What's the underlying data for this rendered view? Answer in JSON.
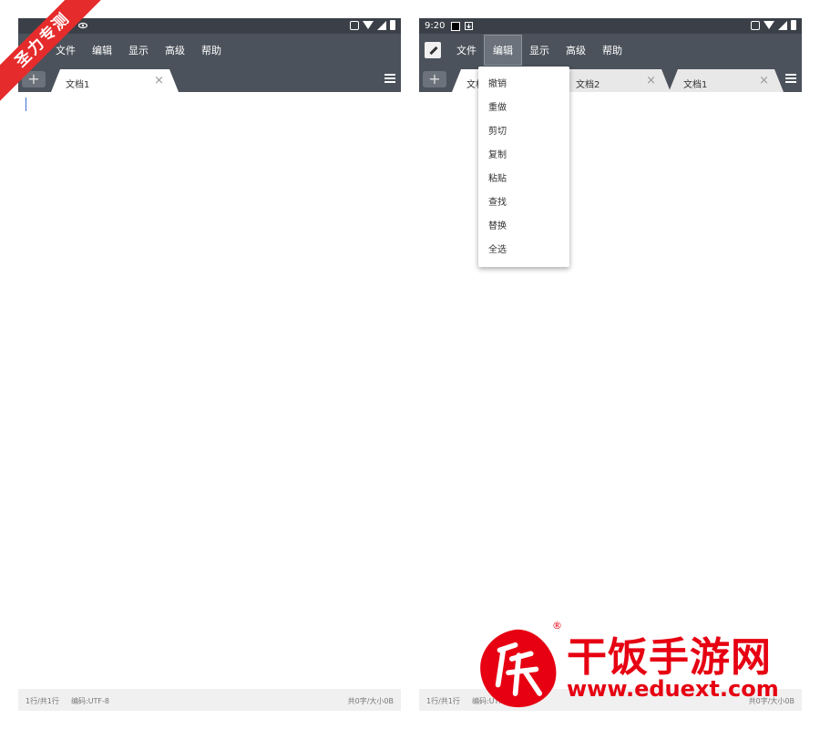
{
  "left": {
    "menu": [
      "文件",
      "编辑",
      "显示",
      "高级",
      "帮助"
    ],
    "tabs": [
      {
        "label": "文档1",
        "close": "×"
      }
    ],
    "add_tab": "+",
    "footer": {
      "lines": "1行/共1行",
      "encoding": "编码:UTF-8",
      "stats": "共0字/大小0B"
    }
  },
  "right": {
    "status_time": "9:20",
    "menu": [
      "文件",
      "编辑",
      "显示",
      "高级",
      "帮助"
    ],
    "active_menu": "编辑",
    "tabs": [
      {
        "label": "文档",
        "close": "×"
      },
      {
        "label": "文档2",
        "close": "×"
      },
      {
        "label": "文档1",
        "close": "×"
      }
    ],
    "add_tab": "+",
    "edit_menu_items": [
      "撤销",
      "重做",
      "剪切",
      "复制",
      "粘贴",
      "查找",
      "替换",
      "全选"
    ],
    "footer": {
      "lines": "1行/共1行",
      "encoding": "编码:UTF-8",
      "stats": "共0字/大小0B"
    }
  },
  "ribbon": "圣力专测",
  "watermark": {
    "name": "干饭手游网",
    "url": "www.eduext.com",
    "reg": "®"
  },
  "colors": {
    "toolbar": "#4b525b",
    "status_bar": "#3b4048",
    "accent_red": "#e60012"
  }
}
